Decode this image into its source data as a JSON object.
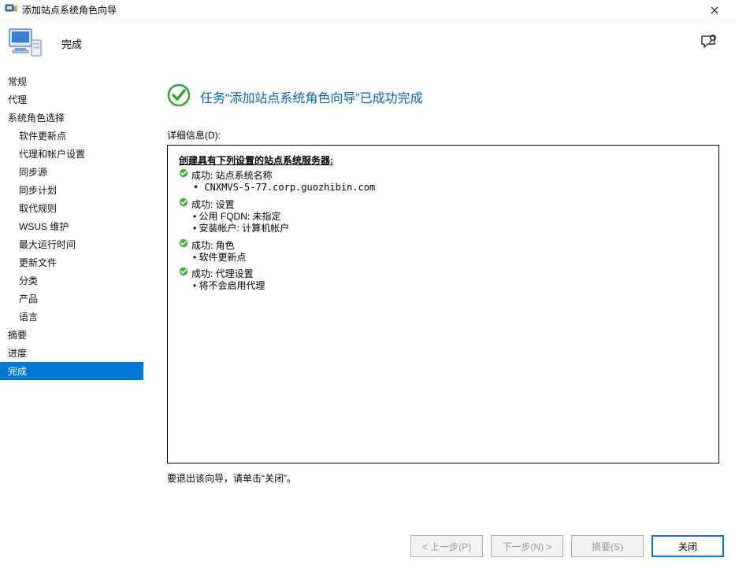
{
  "window": {
    "title": "添加站点系统角色向导"
  },
  "header": {
    "page_title": "完成"
  },
  "sidebar": {
    "items": [
      {
        "label": "常规",
        "indent": false
      },
      {
        "label": "代理",
        "indent": false
      },
      {
        "label": "系统角色选择",
        "indent": false
      },
      {
        "label": "软件更新点",
        "indent": true
      },
      {
        "label": "代理和帐户设置",
        "indent": true
      },
      {
        "label": "同步源",
        "indent": true
      },
      {
        "label": "同步计划",
        "indent": true
      },
      {
        "label": "取代规则",
        "indent": true
      },
      {
        "label": "WSUS 维护",
        "indent": true
      },
      {
        "label": "最大运行时间",
        "indent": true
      },
      {
        "label": "更新文件",
        "indent": true
      },
      {
        "label": "分类",
        "indent": true
      },
      {
        "label": "产品",
        "indent": true
      },
      {
        "label": "语言",
        "indent": true
      },
      {
        "label": "摘要",
        "indent": false
      },
      {
        "label": "进度",
        "indent": false
      },
      {
        "label": "完成",
        "indent": false,
        "selected": true
      }
    ]
  },
  "content": {
    "success_banner": "任务“添加站点系统角色向导”已成功完成",
    "detail_label": "详细信息(D):",
    "heading": "创建具有下列设置的站点系统服务器:",
    "results": [
      {
        "title": "成功: 站点系统名称",
        "sublines": [
          "CNXMVS-5-77.corp.guozhibin.com"
        ],
        "mono": true
      },
      {
        "title": "成功: 设置",
        "sublines": [
          "公用 FQDN: 未指定",
          "安装帐户: 计算机帐户"
        ]
      },
      {
        "title": "成功: 角色",
        "sublines": [
          "软件更新点"
        ]
      },
      {
        "title": "成功: 代理设置",
        "sublines": [
          "将不会启用代理"
        ]
      }
    ],
    "exit_hint": "要退出该向导，请单击“关闭”。",
    "bullet": "•"
  },
  "buttons": {
    "prev": "< 上一步(P)",
    "next": "下一步(N) >",
    "summary": "摘要(S)",
    "close": "关闭"
  }
}
